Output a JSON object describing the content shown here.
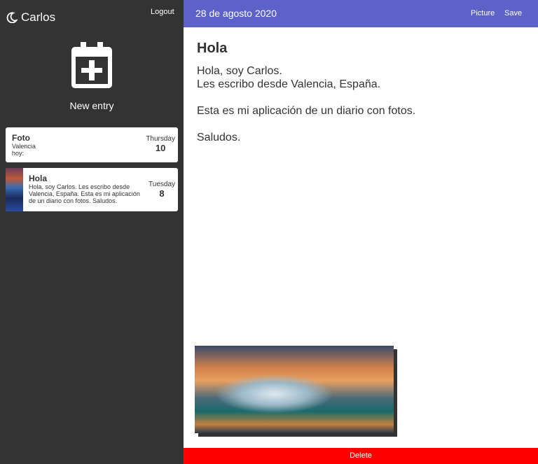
{
  "sidebar": {
    "user": "Carlos",
    "logout": "Logout",
    "new_entry": "New entry",
    "entries": [
      {
        "title": "Foto",
        "lines": [
          "Valencia",
          "hoy:"
        ],
        "weekday": "Thursday",
        "day": "10"
      },
      {
        "title": "Hola",
        "text": "Hola, soy Carlos. Les escribo desde Valencia, España. Esta es mi aplicación de un diario con fotos. Saludos.",
        "weekday": "Tuesday",
        "day": "8"
      }
    ]
  },
  "header": {
    "date": "28 de agosto 2020",
    "picture": "Picture",
    "save": "Save"
  },
  "entry": {
    "title": "Hola",
    "body": "Hola, soy Carlos.\nLes escribo desde Valencia, España.\n\nEsta es mi aplicación de un diario con fotos.\n\nSaludos."
  },
  "delete": "Delete",
  "colors": {
    "sidebar": "#333333",
    "header": "#5c62c7",
    "delete": "#ff0000"
  }
}
